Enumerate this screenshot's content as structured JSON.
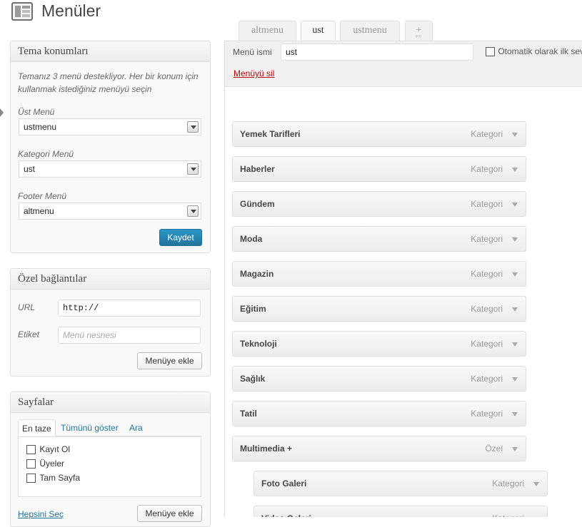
{
  "page": {
    "title": "Menüler"
  },
  "tabs": [
    {
      "label": "altmenu"
    },
    {
      "label": "ust"
    },
    {
      "label": "ustmenu"
    },
    {
      "label": "+"
    }
  ],
  "theme_locations": {
    "heading": "Tema konumları",
    "description": "Temanız 3 menü destekliyor. Her bir konum için kullanmak istediğiniz menüyü seçin",
    "fields": [
      {
        "label": "Üst Menü",
        "value": "ustmenu"
      },
      {
        "label": "Kategori Menü",
        "value": "ust"
      },
      {
        "label": "Footer Menü",
        "value": "altmenu"
      }
    ],
    "save_label": "Kaydet"
  },
  "custom_links": {
    "heading": "Özel bağlantılar",
    "url_label": "URL",
    "url_value": "http://",
    "label_label": "Etiket",
    "label_placeholder": "Menü nesnesi",
    "add_label": "Menüye ekle"
  },
  "pages": {
    "heading": "Sayfalar",
    "tabs": [
      "En taze",
      "Tümünü göster",
      "Ara"
    ],
    "items": [
      "Kayıt Ol",
      "Üyeler",
      "Tam Sayfa"
    ],
    "select_all": "Hepsini Seç",
    "add_label": "Menüye ekle"
  },
  "menu_editor": {
    "name_label": "Menü ismi",
    "name_value": "ust",
    "auto_add_label": "Otomatik olarak ilk sev",
    "delete_label": "Menüyü sil",
    "items": [
      {
        "label": "Yemek Tarifleri",
        "type": "Kategori"
      },
      {
        "label": "Haberler",
        "type": "Kategori"
      },
      {
        "label": "Gündem",
        "type": "Kategori"
      },
      {
        "label": "Moda",
        "type": "Kategori"
      },
      {
        "label": "Magazin",
        "type": "Kategori"
      },
      {
        "label": "Eğitim",
        "type": "Kategori"
      },
      {
        "label": "Teknoloji",
        "type": "Kategori"
      },
      {
        "label": "Sağlık",
        "type": "Kategori"
      },
      {
        "label": "Tatil",
        "type": "Kategori"
      },
      {
        "label": "Multimedia +",
        "type": "Özel"
      },
      {
        "label": "Foto Galeri",
        "type": "Kategori"
      },
      {
        "label": "Video Galeri",
        "type": "Kategori"
      }
    ]
  },
  "colors": {
    "primary_button": "#21759b",
    "link": "#21759b",
    "delete_link": "#bc0b0b"
  }
}
